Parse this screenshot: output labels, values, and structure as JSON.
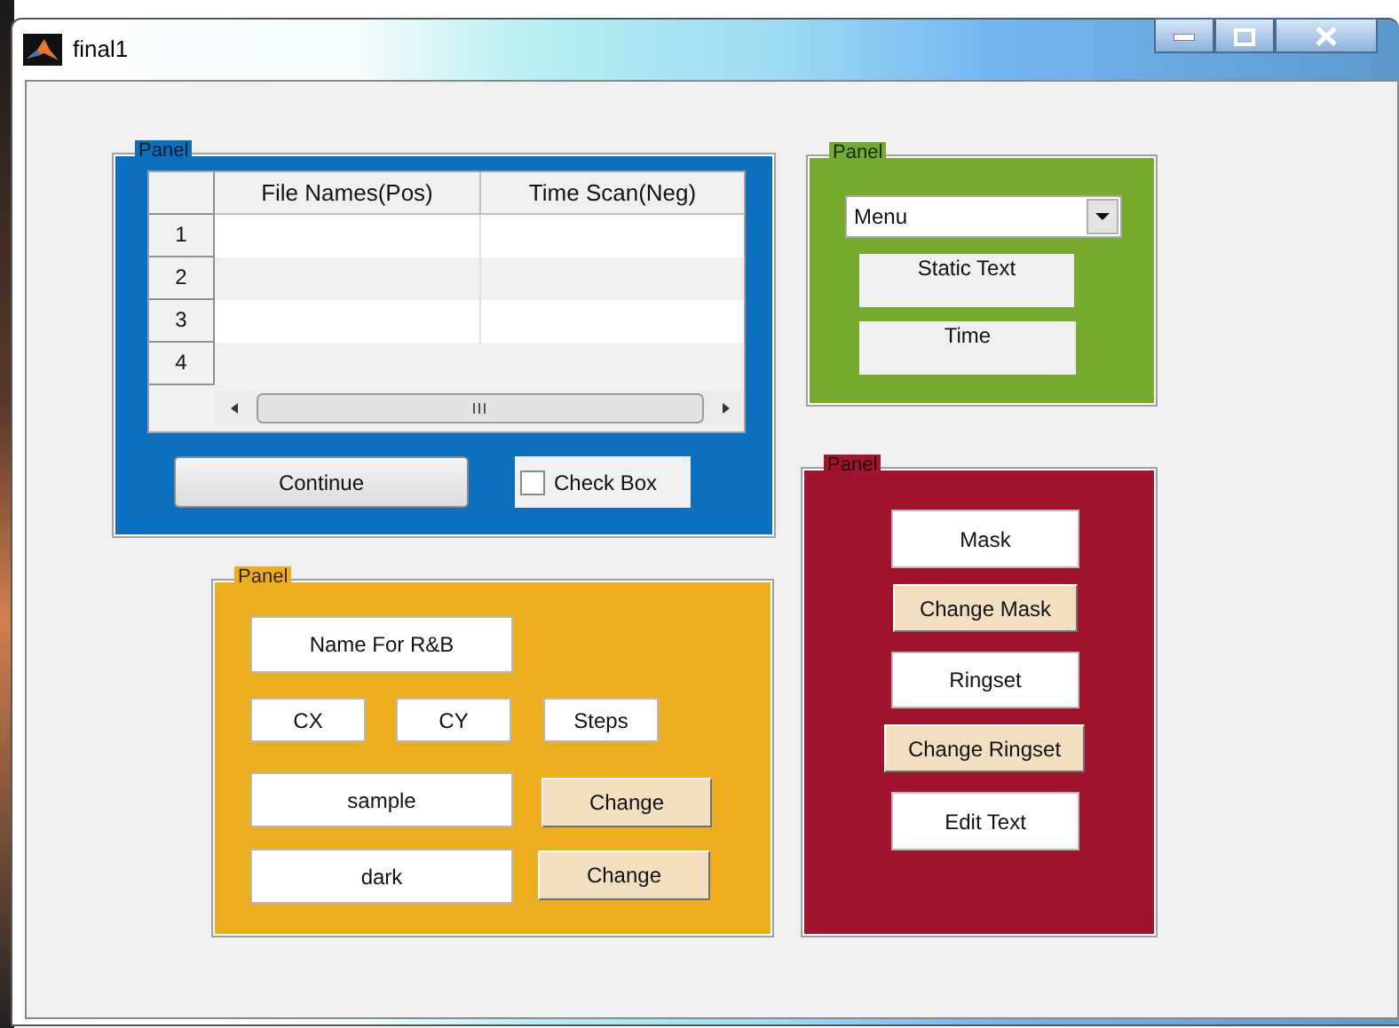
{
  "window": {
    "title": "final1"
  },
  "panels": [
    {
      "title": "Panel",
      "color": "#0c6fbd",
      "items": [
        {
          "kind": "table",
          "columns": [
            "File Names(Pos)",
            "Time Scan(Neg)"
          ],
          "rows": [
            "1",
            "2",
            "3",
            "4"
          ]
        },
        {
          "kind": "button",
          "label": "Continue",
          "color": "#e6e6e6"
        },
        {
          "kind": "checkbox",
          "label": "Check Box",
          "checked": false
        }
      ]
    },
    {
      "title": "Panel",
      "color": "#77ab2f",
      "items": [
        {
          "kind": "popup",
          "value": "Menu"
        },
        {
          "kind": "static",
          "text": "Static Text"
        },
        {
          "kind": "static",
          "text": "Time"
        }
      ]
    },
    {
      "title": "Panel",
      "color": "#a0142e",
      "items": [
        {
          "kind": "field",
          "value": "Mask"
        },
        {
          "kind": "button",
          "label": "Change Mask",
          "color": "#f3dfbf"
        },
        {
          "kind": "field",
          "value": "Ringset"
        },
        {
          "kind": "button",
          "label": "Change Ringset",
          "color": "#f3dfbf"
        },
        {
          "kind": "field",
          "value": "Edit Text"
        }
      ]
    },
    {
      "title": "Panel",
      "color": "#ecae1f",
      "items": [
        {
          "kind": "field",
          "value": "Name For R&B"
        },
        {
          "kind": "field",
          "value": "CX"
        },
        {
          "kind": "field",
          "value": "CY"
        },
        {
          "kind": "field",
          "value": "Steps"
        },
        {
          "kind": "field",
          "value": "sample"
        },
        {
          "kind": "button",
          "label": "Change",
          "color": "#f3dfbf"
        },
        {
          "kind": "field",
          "value": "dark"
        },
        {
          "kind": "button",
          "label": "Change",
          "color": "#f3dfbf"
        }
      ]
    }
  ]
}
